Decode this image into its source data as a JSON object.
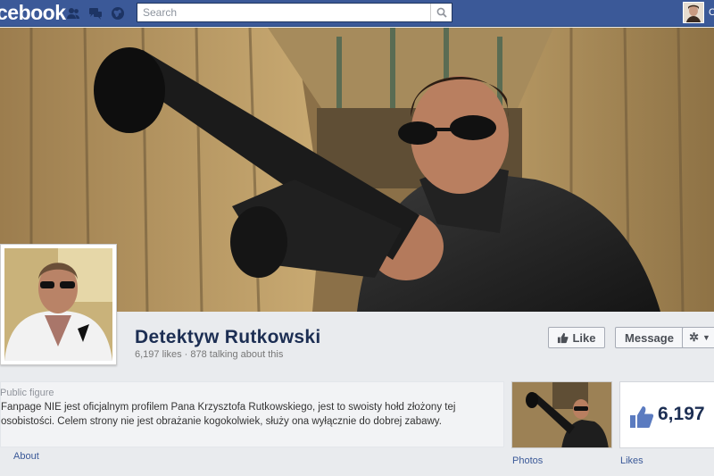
{
  "topbar": {
    "logo": "facebook",
    "logo_visible": "cebook",
    "search_placeholder": "Search",
    "icons": [
      "friend-requests-icon",
      "messages-icon",
      "notifications-icon",
      "search-icon"
    ],
    "user_initial": "C"
  },
  "page": {
    "name": "Detektyw Rutkowski",
    "stats": "6,197 likes · 878 talking about this"
  },
  "actions": {
    "like_label": "Like",
    "message_label": "Message"
  },
  "info": {
    "type": "Public figure",
    "description": "Fanpage NIE jest oficjalnym profilem Pana Krzysztofa Rutkowskiego, jest to swoisty hołd złożony tej osobistości. Celem strony nie jest obrażanie kogokolwiek, służy ona wyłącznie do dobrej zabawy.",
    "about_label": "About"
  },
  "apps": {
    "photos_label": "Photos",
    "likes_count": "6,197",
    "likes_label": "Likes"
  },
  "colors": {
    "brand": "#3b5998",
    "page_name": "#1c2e53"
  }
}
